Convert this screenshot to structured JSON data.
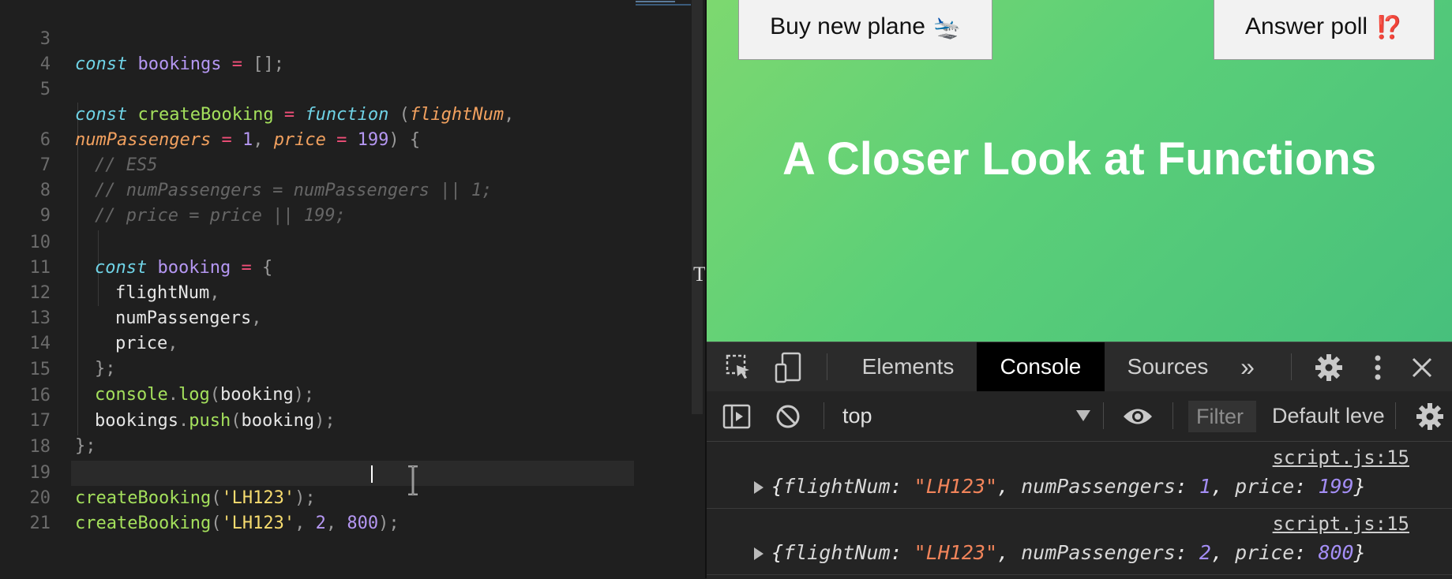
{
  "editor": {
    "lines": [
      {
        "n": "3"
      },
      {
        "n": "4"
      },
      {
        "n": "5"
      },
      {
        "n": ""
      },
      {
        "n": "6"
      },
      {
        "n": "7"
      },
      {
        "n": "8"
      },
      {
        "n": "9"
      },
      {
        "n": "10"
      },
      {
        "n": "11"
      },
      {
        "n": "12"
      },
      {
        "n": "13"
      },
      {
        "n": "14"
      },
      {
        "n": "15"
      },
      {
        "n": "16"
      },
      {
        "n": "17"
      },
      {
        "n": "18"
      },
      {
        "n": "19"
      },
      {
        "n": "20"
      },
      {
        "n": "21"
      }
    ],
    "t": {
      "const": "const",
      "function": "function",
      "bookings": "bookings",
      "booking": "booking",
      "createBooking": "createBooking",
      "flightNum": "flightNum",
      "numPassengers": "numPassengers",
      "price": "price",
      "eq": "=",
      "emptyArr": "[];",
      "one": "1",
      "n199": "199",
      "two": "2",
      "n800": "800",
      "cmt1": "// ES5",
      "cmt2": "// numPassengers = numPassengers || 1;",
      "cmt3": "// price = price || 199;",
      "console": "console",
      "log": "log",
      "push": "push",
      "lh123": "'LH123'"
    }
  },
  "page": {
    "buy_button": "Buy new plane",
    "buy_emoji": "🛬",
    "poll_button": "Answer poll",
    "poll_emoji": "⁉️",
    "title": "A Closer Look at Functions"
  },
  "devtools": {
    "tabs": {
      "elements": "Elements",
      "console": "Console",
      "sources": "Sources",
      "more": "»"
    },
    "context": "top",
    "filter_placeholder": "Filter",
    "levels": "Default levels",
    "logs": [
      {
        "source": "script.js:15",
        "flightNum": "\"LH123\"",
        "numPassengers": "1",
        "price": "199"
      },
      {
        "source": "script.js:15",
        "flightNum": "\"LH123\"",
        "numPassengers": "2",
        "price": "800"
      }
    ],
    "keys": {
      "flightNum": "flightNum",
      "numPassengers": "numPassengers",
      "price": "price"
    }
  }
}
